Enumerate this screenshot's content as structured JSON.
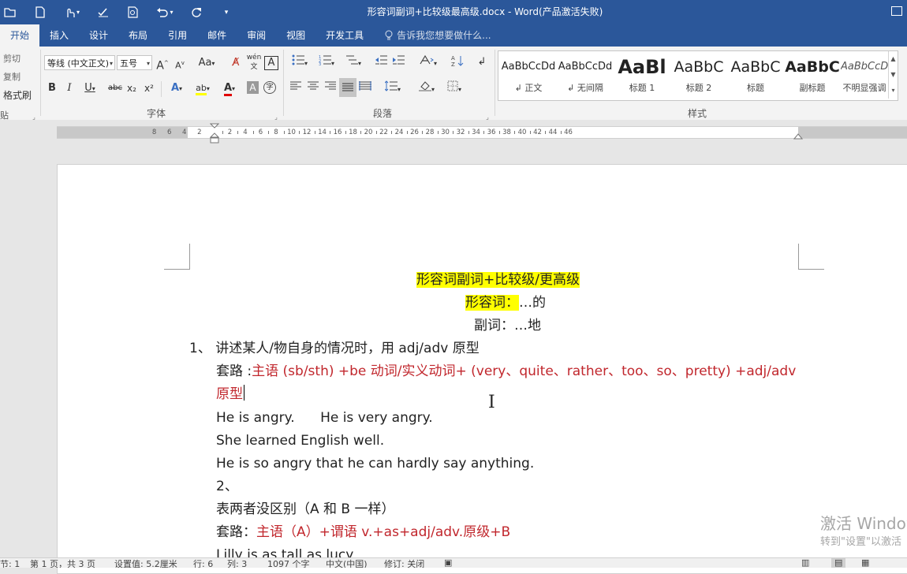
{
  "window": {
    "title": "形容词副词+比较级最高级.docx - Word(产品激活失败)"
  },
  "qat": {
    "icons": [
      "open-icon",
      "new-doc-icon",
      "touch-mode-icon",
      "spelling-icon",
      "print-preview-icon",
      "undo-icon",
      "redo-icon",
      "customize-icon"
    ]
  },
  "tabs": [
    "开始",
    "插入",
    "设计",
    "布局",
    "引用",
    "邮件",
    "审阅",
    "视图",
    "开发工具"
  ],
  "tell_me": "告诉我您想要做什么...",
  "clipboard": {
    "cut": "剪切",
    "copy": "复制",
    "format_painter": "格式刷"
  },
  "font": {
    "name": "等线 (中文正文)",
    "size": "五号",
    "group_label": "字体",
    "grow": "A",
    "shrink": "A",
    "case": "Aa",
    "phonetic": "wén",
    "border_char": "A",
    "bold": "B",
    "italic": "I",
    "underline": "U",
    "strike": "abc",
    "sub": "x₂",
    "sup": "x²",
    "effects": "A",
    "highlight": "ab",
    "color": "A",
    "shade": "A",
    "enclose": "字"
  },
  "paragraph": {
    "group_label": "段落"
  },
  "styles": {
    "group_label": "样式",
    "items": [
      {
        "preview": "AaBbCcDd",
        "name": "↲ 正文"
      },
      {
        "preview": "AaBbCcDd",
        "name": "↲ 无间隔"
      },
      {
        "preview": "AaBl",
        "name": "标题 1"
      },
      {
        "preview": "AaBbC",
        "name": "标题 2"
      },
      {
        "preview": "AaBbC",
        "name": "标题"
      },
      {
        "preview": "AaBbC",
        "name": "副标题"
      },
      {
        "preview": "AaBbCcD",
        "name": "不明显强调"
      }
    ]
  },
  "ruler": {
    "left_labels": [
      "8",
      "6",
      "4",
      "2"
    ],
    "right_labels": [
      "2",
      "4",
      "6",
      "8",
      "10",
      "12",
      "14",
      "16",
      "18",
      "20",
      "22",
      "24",
      "26",
      "28",
      "30",
      "32",
      "34",
      "36",
      "38",
      "40",
      "42",
      "44",
      "46"
    ]
  },
  "document": {
    "title": "形容词副词+比较级/更高级",
    "adj_label": "形容词：",
    "adj_meaning": "…的",
    "adv_line": "副词：…地",
    "item1_num": "1、",
    "item1_text": "讲述某人/物自身的情况时，用 adj/adv 原型",
    "pattern1_label": "套路 :",
    "pattern1_red": "主语 (sb/sth) +be 动词/实义动词+ (very、quite、rather、too、so、pretty) +adj/adv",
    "pattern1_red2": "原型",
    "ex1": "He is angry.      He is very angry.",
    "ex2": "She learned English well.",
    "ex3": "He is so angry that he can hardly say anything.",
    "item2_num": "2、",
    "item2_text": "表两者没区别（A 和 B 一样）",
    "pattern2_label": "套路：",
    "pattern2_red": "主语（A）+谓语 v.+as+adj/adv.原级+B",
    "ex4": "Lilly is as tall as lucy"
  },
  "watermark": {
    "line1": "激活 Windows",
    "line2": "转到\"设置\"以激活"
  },
  "status": {
    "section": "节: 1",
    "page": "第 1 页，共 3 页",
    "position": "设置值: 5.2厘米",
    "row": "行: 6",
    "col": "列: 3",
    "words": "1097 个字",
    "lang": "中文(中国)",
    "revision": "修订: 关闭"
  }
}
